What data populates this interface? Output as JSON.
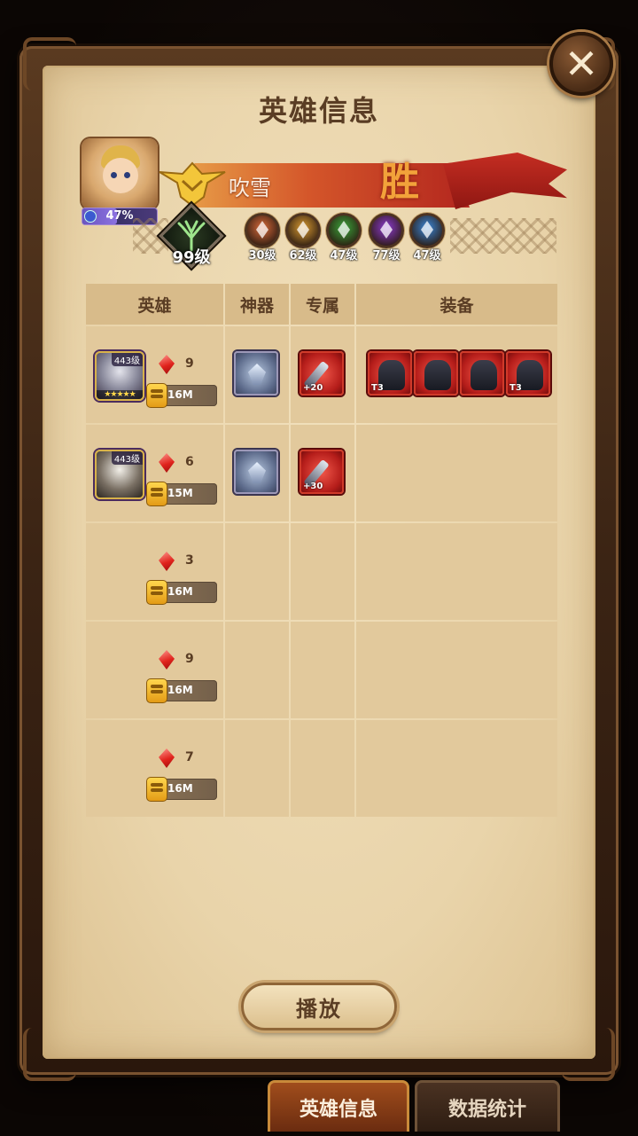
{
  "dialog": {
    "title": "英雄信息",
    "close_icon": "close-x-icon"
  },
  "player": {
    "name": "吹雪",
    "progress_text": "47%",
    "progress": 0.47,
    "result": "胜",
    "level_text": "99级"
  },
  "factions": [
    {
      "name": "lightbearer",
      "level": "30级",
      "color": "#d96a3a"
    },
    {
      "name": "mauler",
      "level": "62级",
      "color": "#d89a32"
    },
    {
      "name": "wilder",
      "level": "47级",
      "color": "#3aa43a"
    },
    {
      "name": "graveborn",
      "level": "77级",
      "color": "#8c3ad0"
    },
    {
      "name": "celestial",
      "level": "47级",
      "color": "#3a86d8"
    }
  ],
  "table": {
    "headers": [
      "英雄",
      "神器",
      "专属",
      "装备"
    ],
    "rows": [
      {
        "hero_level": "443级",
        "hero_stars": "★★★★★",
        "gems": "9",
        "power": "16M",
        "artifact": true,
        "exclusive_plus": "+20",
        "gear": [
          {
            "tier": "T3"
          },
          {
            "tier": ""
          },
          {
            "tier": ""
          },
          {
            "tier": "T3"
          }
        ]
      },
      {
        "hero_level": "443级",
        "hero_stars": "",
        "gems": "6",
        "power": "15M",
        "artifact": true,
        "exclusive_plus": "+30",
        "gear": []
      },
      {
        "gems": "3",
        "power": "16M",
        "gear": []
      },
      {
        "gems": "9",
        "power": "16M",
        "gear": []
      },
      {
        "gems": "7",
        "power": "16M",
        "gear": []
      }
    ]
  },
  "play_button": "播放",
  "tabs": [
    {
      "label": "英雄信息",
      "active": true
    },
    {
      "label": "数据统计",
      "active": false
    }
  ]
}
